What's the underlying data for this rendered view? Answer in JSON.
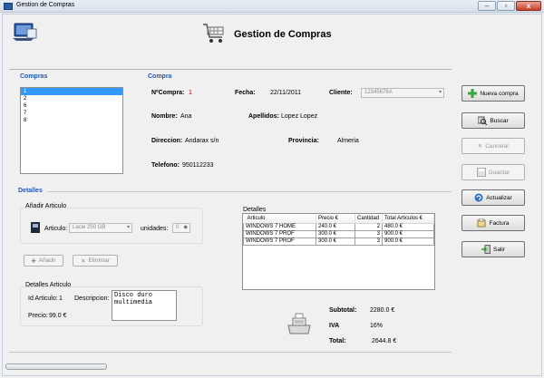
{
  "window": {
    "title": "Gestion de Compras"
  },
  "header": {
    "title": "Gestion de Compras"
  },
  "compras_list": {
    "title": "Compras",
    "items": [
      "1",
      "2",
      "6",
      "7",
      "8"
    ]
  },
  "compra": {
    "title": "Compra",
    "num_label": "NºCompra:",
    "num_value": "1",
    "fecha_label": "Fecha:",
    "fecha_value": "22/11/2011",
    "cliente_label": "Cliente:",
    "cliente_value": "12345678A",
    "nombre_label": "Nombre:",
    "nombre_value": "Ana",
    "apellidos_label": "Apellidos:",
    "apellidos_value": "Lopez Lopez",
    "direccion_label": "Direccion:",
    "direccion_value": "Andarax s/n",
    "provincia_label": "Provincia:",
    "provincia_value": "Almeria",
    "telefono_label": "Telefono:",
    "telefono_value": "950112233"
  },
  "detalles": {
    "title": "Detalles",
    "add_group_title": "Añadir Articulo",
    "articulo_label": "Articulo:",
    "articulo_value": "Lacie 250 GB",
    "unidades_label": "unidades:",
    "unidades_value": "0",
    "add_button": "Añadir",
    "remove_button": "Eliminar",
    "detail_group_title": "Detalles Articulo",
    "id_label": "Id Articulo:",
    "id_value": "1",
    "descripcion_label": "Descripcion:",
    "descripcion_value": "Disco duro multimedia",
    "precio_label": "Precio:",
    "precio_value": "99.0 €"
  },
  "lines_table": {
    "title": "Detalles",
    "columns": [
      "Articulo",
      "Precio €",
      "Cantidad",
      "Total Articulos €"
    ],
    "rows": [
      [
        "WINDOWS 7 HOME",
        "240.0 €",
        "2",
        "480.0 €"
      ],
      [
        "WINDOWS 7 PROF",
        "300.0 €",
        "3",
        "900.0 €"
      ],
      [
        "WINDOWS 7 PROF",
        "300.0 €",
        "3",
        "900.0 €"
      ]
    ]
  },
  "totals": {
    "subtotal_label": "Subtotal:",
    "subtotal_value": "2280.0 €",
    "iva_label": "IVA",
    "iva_value": "16%",
    "total_label": "Total:",
    "total_value": "2644.8 €"
  },
  "actions": {
    "nueva": "Nueva compra",
    "buscar": "Buscar",
    "cancelar": "Cancelar",
    "guardar": "Guardar",
    "actualizar": "Actualizar",
    "factura": "Factura",
    "salir": "Salir"
  },
  "colors": {
    "section_title": "#1f5ab5",
    "selection": "#3399ff",
    "highlight_red": "#cc0000"
  },
  "icons": [
    "app-icon",
    "shopping-cart-icon",
    "plus-icon",
    "search-icon",
    "cancel-icon",
    "save-icon",
    "refresh-icon",
    "invoice-icon",
    "exit-icon",
    "cash-register-icon",
    "product-icon"
  ]
}
